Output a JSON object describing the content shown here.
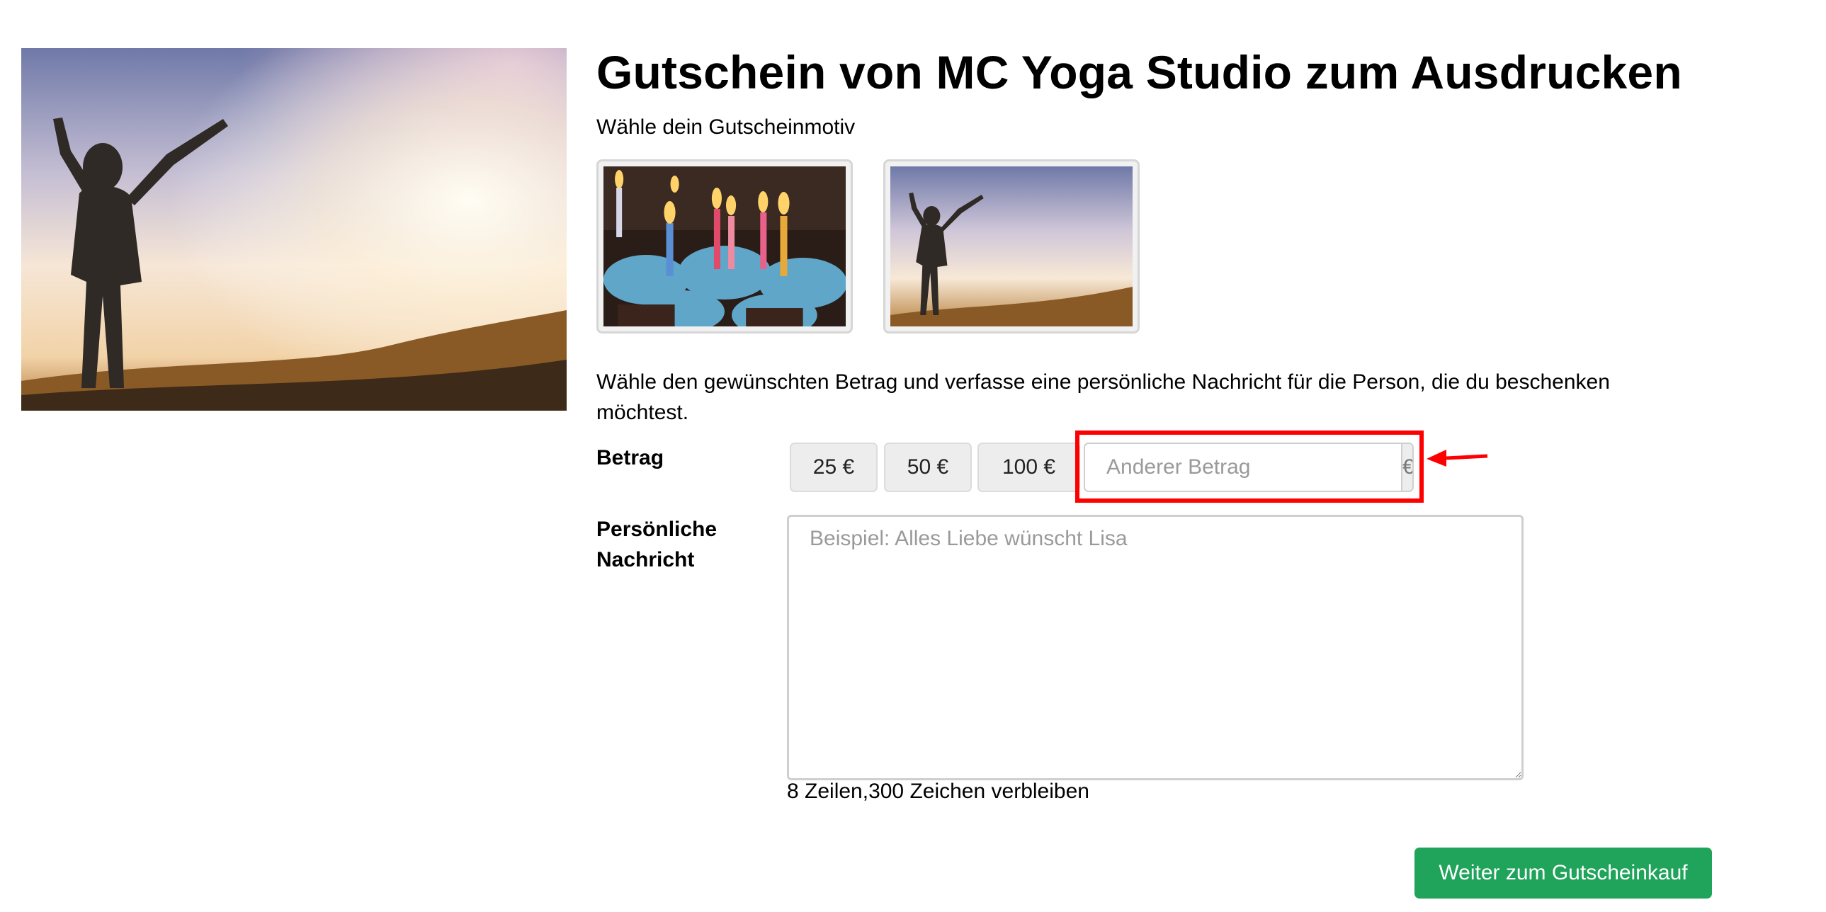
{
  "page": {
    "title": "Gutschein von MC Yoga Studio zum Ausdrucken",
    "motif_prompt": "Wähle dein Gutscheinmotiv",
    "description": "Wähle den gewünschten Betrag und verfasse eine persönliche Nachricht für die Person, die du beschenken möchtest."
  },
  "motifs": [
    {
      "name": "birthday-cupcakes"
    },
    {
      "name": "yoga-sunrise",
      "selected": true
    }
  ],
  "amount": {
    "label": "Betrag",
    "options": [
      "25 €",
      "50 €",
      "100 €"
    ],
    "custom_placeholder": "Anderer Betrag",
    "currency": "€"
  },
  "message": {
    "label": "Persönliche Nachricht",
    "placeholder": "Beispiel: Alles Liebe wünscht Lisa",
    "counter": "8 Zeilen,300 Zeichen verbleiben"
  },
  "actions": {
    "submit_label": "Weiter zum Gutscheinkauf"
  },
  "colors": {
    "accent_green": "#20a35a",
    "highlight_red": "#ff0000"
  }
}
